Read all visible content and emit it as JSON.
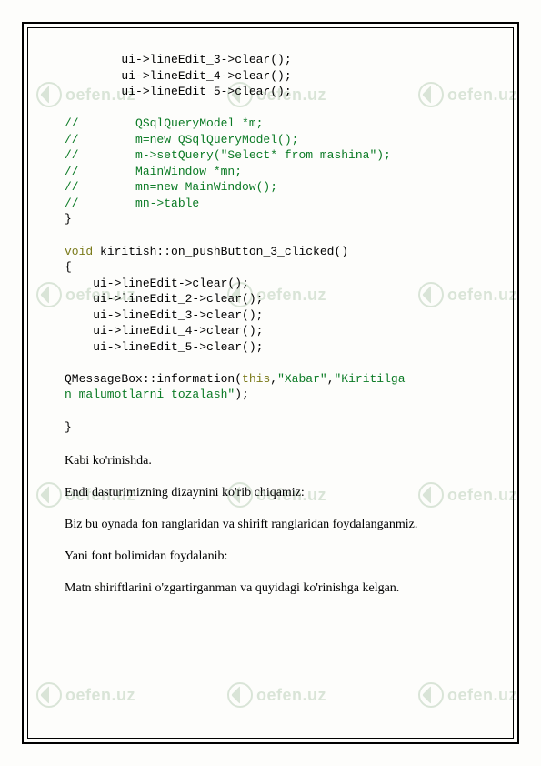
{
  "watermark": "oefen.uz",
  "code": {
    "ln1": "        ui->lineEdit_3->clear();",
    "ln2": "        ui->lineEdit_4->clear();",
    "ln3": "        ui->lineEdit_5->clear();",
    "ln4": "",
    "c1": "//        QSqlQueryModel *m;",
    "c2": "//        m=new QSqlQueryModel();",
    "c3": "//        m->setQuery(\"Select* from mashina\");",
    "c4": "//        MainWindow *mn;",
    "c5": "//        mn=new MainWindow();",
    "c6": "//        mn->table",
    "closeBrace": "}",
    "kw_void": "void",
    "fn_sig": " kiritish::on_pushButton_3_clicked()",
    "openBrace": "{",
    "b1": "    ui->lineEdit->clear();",
    "b2": "    ui->lineEdit_2->clear();",
    "b3": "    ui->lineEdit_3->clear();",
    "b4": "    ui->lineEdit_4->clear();",
    "b5": "    ui->lineEdit_5->clear();",
    "msg1": "QMessageBox::information(",
    "msg_this": "this",
    "msg_comma1": ",",
    "msg_str1": "\"Xabar\"",
    "msg_comma2": ",",
    "msg_str2a": "\"Kiritilga",
    "msg_str2b": "n malumotlarni tozalash\"",
    "msg_end": ");",
    "closeBrace2": "}"
  },
  "paragraphs": {
    "p1": "Kabi ko'rinishda.",
    "p2": "Endi dasturimizning dizaynini ko'rib chiqamiz:",
    "p3": "Biz bu oynada fon ranglaridan va shirift ranglaridan foydalanganmiz.",
    "p4": "Yani font bolimidan foydalanib:",
    "p5": "Matn shiriftlarini o'zgartirganman va quyidagi ko'rinishga kelgan."
  }
}
